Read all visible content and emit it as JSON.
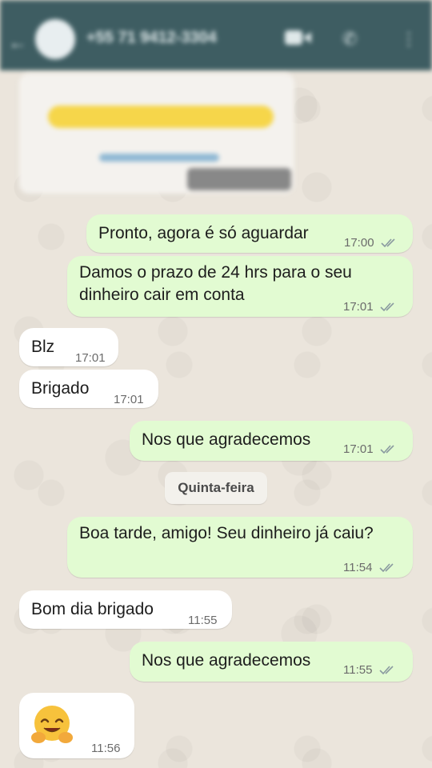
{
  "header": {
    "contact_name": "+55 71 9412-3304"
  },
  "date_separator": "Quinta-feira",
  "messages": [
    {
      "text": "Pronto, agora é só aguardar",
      "time": "17:00"
    },
    {
      "text": "Damos  o prazo de 24 hrs para o seu dinheiro cair em conta",
      "time": "17:01"
    },
    {
      "text": "Blz",
      "time": "17:01"
    },
    {
      "text": "Brigado",
      "time": "17:01"
    },
    {
      "text": "Nos que agradecemos",
      "time": "17:01"
    },
    {
      "text": "Boa tarde, amigo! Seu dinheiro já caiu?",
      "time": "11:54"
    },
    {
      "text": "Bom dia brigado",
      "time": "11:55"
    },
    {
      "text": "Nos que agradecemos",
      "time": "11:55"
    },
    {
      "text": "🤗",
      "time": "11:56"
    }
  ],
  "colors": {
    "outgoing_bubble": "#e2fbd2",
    "incoming_bubble": "#ffffff",
    "header": "#3e5d62",
    "read_ticks": "#8a9aa0"
  },
  "icons": [
    "back-arrow-icon",
    "video-call-icon",
    "phone-icon",
    "more-vert-icon",
    "double-check-icon",
    "hugging-face-emoji"
  ]
}
